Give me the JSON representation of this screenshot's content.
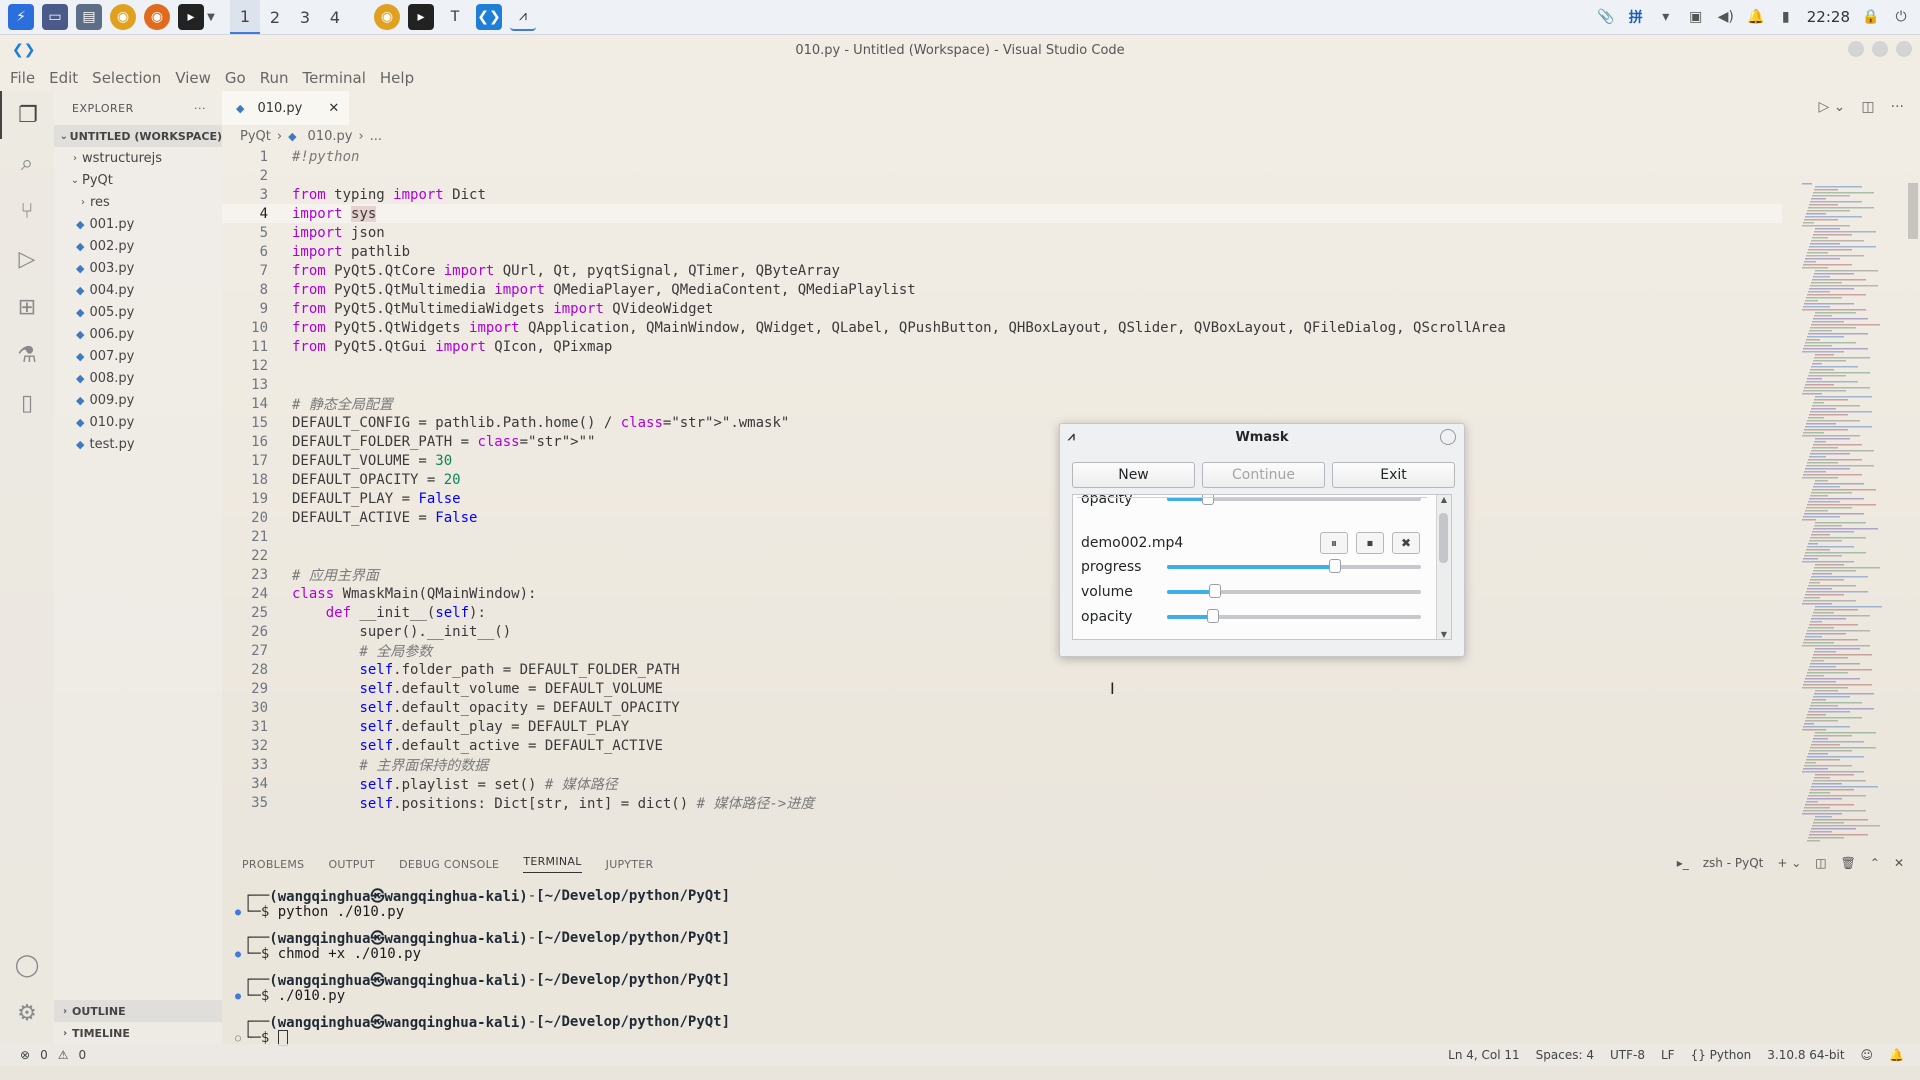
{
  "taskbar": {
    "workspaces": [
      "1",
      "2",
      "3",
      "4"
    ],
    "active_workspace": "1",
    "clock": "22:28"
  },
  "window": {
    "title": "010.py - Untitled (Workspace) - Visual Studio Code"
  },
  "menu": [
    "File",
    "Edit",
    "Selection",
    "View",
    "Go",
    "Run",
    "Terminal",
    "Help"
  ],
  "sidebar": {
    "header": "EXPLORER",
    "header_more": "···",
    "workspace": "UNTITLED (WORKSPACE)",
    "items": [
      {
        "label": "wstructurejs",
        "type": "folder",
        "depth": 1,
        "chevron": "›"
      },
      {
        "label": "PyQt",
        "type": "folder",
        "depth": 1,
        "chevron": "⌄"
      },
      {
        "label": "res",
        "type": "folder",
        "depth": 2,
        "chevron": "›"
      },
      {
        "label": "001.py",
        "type": "file",
        "depth": 2
      },
      {
        "label": "002.py",
        "type": "file",
        "depth": 2
      },
      {
        "label": "003.py",
        "type": "file",
        "depth": 2
      },
      {
        "label": "004.py",
        "type": "file",
        "depth": 2
      },
      {
        "label": "005.py",
        "type": "file",
        "depth": 2
      },
      {
        "label": "006.py",
        "type": "file",
        "depth": 2
      },
      {
        "label": "007.py",
        "type": "file",
        "depth": 2
      },
      {
        "label": "008.py",
        "type": "file",
        "depth": 2
      },
      {
        "label": "009.py",
        "type": "file",
        "depth": 2
      },
      {
        "label": "010.py",
        "type": "file",
        "depth": 2
      },
      {
        "label": "test.py",
        "type": "file",
        "depth": 2
      }
    ],
    "outline": "OUTLINE",
    "timeline": "TIMELINE"
  },
  "editor": {
    "tab": "010.py",
    "breadcrumb": [
      "PyQt",
      "010.py",
      "..."
    ]
  },
  "code": [
    {
      "n": "1",
      "text": "#!python"
    },
    {
      "n": "2",
      "text": ""
    },
    {
      "n": "3",
      "text": "from typing import Dict"
    },
    {
      "n": "4",
      "text": "import sys"
    },
    {
      "n": "5",
      "text": "import json"
    },
    {
      "n": "6",
      "text": "import pathlib"
    },
    {
      "n": "7",
      "text": "from PyQt5.QtCore import QUrl, Qt, pyqtSignal, QTimer, QByteArray"
    },
    {
      "n": "8",
      "text": "from PyQt5.QtMultimedia import QMediaPlayer, QMediaContent, QMediaPlaylist"
    },
    {
      "n": "9",
      "text": "from PyQt5.QtMultimediaWidgets import QVideoWidget"
    },
    {
      "n": "10",
      "text": "from PyQt5.QtWidgets import QApplication, QMainWindow, QWidget, QLabel, QPushButton, QHBoxLayout, QSlider, QVBoxLayout, QFileDialog, QScrollArea"
    },
    {
      "n": "11",
      "text": "from PyQt5.QtGui import QIcon, QPixmap"
    },
    {
      "n": "12",
      "text": ""
    },
    {
      "n": "13",
      "text": ""
    },
    {
      "n": "14",
      "text": "# 静态全局配置"
    },
    {
      "n": "15",
      "text": "DEFAULT_CONFIG = pathlib.Path.home() / \".wmask\""
    },
    {
      "n": "16",
      "text": "DEFAULT_FOLDER_PATH = \"\""
    },
    {
      "n": "17",
      "text": "DEFAULT_VOLUME = 30"
    },
    {
      "n": "18",
      "text": "DEFAULT_OPACITY = 20"
    },
    {
      "n": "19",
      "text": "DEFAULT_PLAY = False"
    },
    {
      "n": "20",
      "text": "DEFAULT_ACTIVE = False"
    },
    {
      "n": "21",
      "text": ""
    },
    {
      "n": "22",
      "text": ""
    },
    {
      "n": "23",
      "text": "# 应用主界面"
    },
    {
      "n": "24",
      "text": "class WmaskMain(QMainWindow):"
    },
    {
      "n": "25",
      "text": "    def __init__(self):"
    },
    {
      "n": "26",
      "text": "        super().__init__()"
    },
    {
      "n": "27",
      "text": "        # 全局参数"
    },
    {
      "n": "28",
      "text": "        self.folder_path = DEFAULT_FOLDER_PATH"
    },
    {
      "n": "29",
      "text": "        self.default_volume = DEFAULT_VOLUME"
    },
    {
      "n": "30",
      "text": "        self.default_opacity = DEFAULT_OPACITY"
    },
    {
      "n": "31",
      "text": "        self.default_play = DEFAULT_PLAY"
    },
    {
      "n": "32",
      "text": "        self.default_active = DEFAULT_ACTIVE"
    },
    {
      "n": "33",
      "text": "        # 主界面保持的数据"
    },
    {
      "n": "34",
      "text": "        self.playlist = set() # 媒体路径"
    },
    {
      "n": "35",
      "text": "        self.positions: Dict[str, int] = dict() # 媒体路径->进度"
    }
  ],
  "panel": {
    "tabs": [
      "PROBLEMS",
      "OUTPUT",
      "DEBUG CONSOLE",
      "TERMINAL",
      "JUPYTER"
    ],
    "active_tab": "TERMINAL",
    "terminal_name": "zsh - PyQt",
    "terminal": [
      {
        "user": "(wangqinghua㉿wangqinghua-kali)",
        "path": "[~/Develop/python/PyQt]",
        "cmd": "python ./010.py",
        "dot": "filled"
      },
      {
        "user": "(wangqinghua㉿wangqinghua-kali)",
        "path": "[~/Develop/python/PyQt]",
        "cmd": "chmod +x ./010.py",
        "dot": "filled"
      },
      {
        "user": "(wangqinghua㉿wangqinghua-kali)",
        "path": "[~/Develop/python/PyQt]",
        "cmd": "./010.py",
        "dot": "filled"
      },
      {
        "user": "(wangqinghua㉿wangqinghua-kali)",
        "path": "[~/Develop/python/PyQt]",
        "cmd": "",
        "dot": "empty"
      }
    ]
  },
  "statusbar": {
    "errors": "0",
    "warnings": "0",
    "position": "Ln 4, Col 11",
    "spaces": "Spaces: 4",
    "encoding": "UTF-8",
    "eol": "LF",
    "language": "Python",
    "interpreter": "3.10.8 64-bit"
  },
  "wmask": {
    "title": "Wmask",
    "buttons": {
      "new": "New",
      "continue": "Continue",
      "exit": "Exit"
    },
    "partial_label": "opacity",
    "media": {
      "filename": "demo002.mp4",
      "progress_label": "progress",
      "volume_label": "volume",
      "opacity_label": "opacity",
      "progress": 0.66,
      "volume": 0.19,
      "opacity": 0.18
    }
  },
  "colors": {
    "accent": "#3daee9",
    "vscode_blue": "#1f7fd6",
    "keyword": "#af00db",
    "string": "#a31515"
  }
}
